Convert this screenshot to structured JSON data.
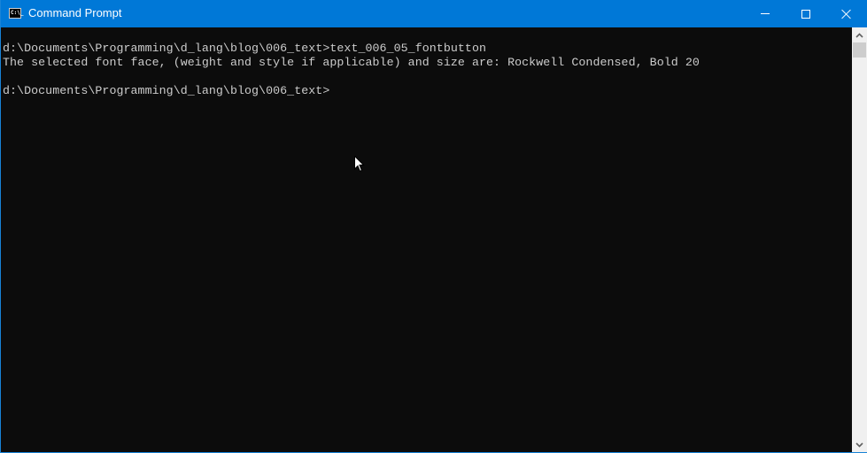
{
  "window": {
    "title": "Command Prompt",
    "icon": "cmd-icon",
    "icon_text": "C:\\_",
    "controls": [
      "minimize-icon",
      "maximize-icon",
      "close-icon"
    ],
    "accent_color": "#0078d7"
  },
  "console": {
    "background": "#0c0c0c",
    "foreground": "#cccccc",
    "lines": [
      "d:\\Documents\\Programming\\d_lang\\blog\\006_text>text_006_05_fontbutton",
      "The selected font face, (weight and style if applicable) and size are: Rockwell Condensed, Bold 20",
      "",
      "d:\\Documents\\Programming\\d_lang\\blog\\006_text>"
    ]
  },
  "scrollbar": {
    "up_icon": "chevron-up-icon",
    "down_icon": "chevron-down-icon"
  }
}
